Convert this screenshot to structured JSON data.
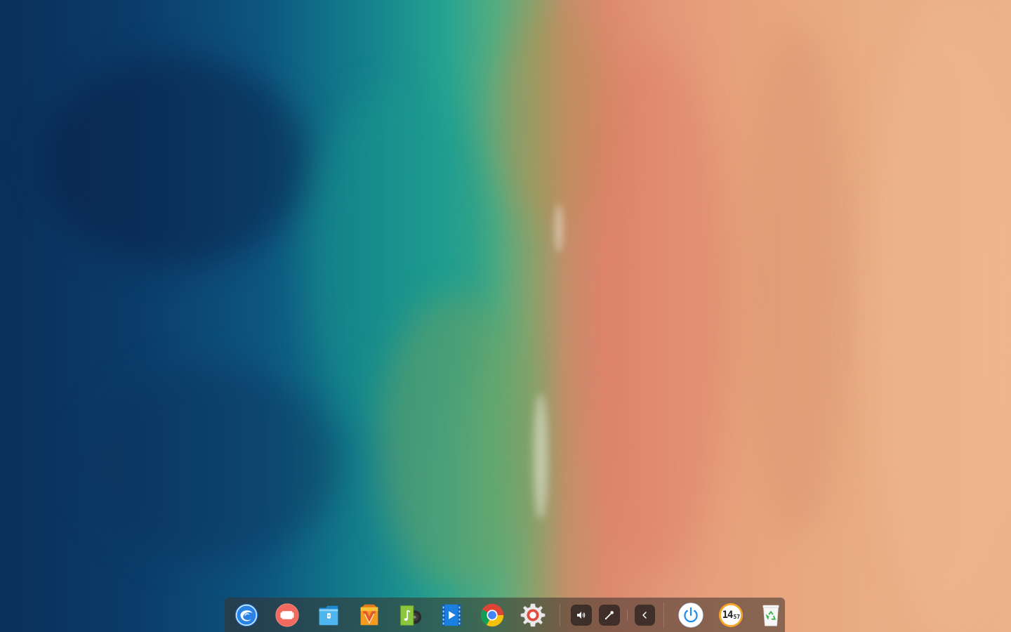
{
  "desktop": {
    "wallpaper": "aerial-beach-ocean"
  },
  "dock": {
    "apps": [
      {
        "name": "launcher",
        "icon": "deepin-launcher-icon"
      },
      {
        "name": "screen-recorder",
        "icon": "screen-recorder-icon"
      },
      {
        "name": "file-manager",
        "icon": "file-manager-icon"
      },
      {
        "name": "app-store",
        "icon": "app-store-icon"
      },
      {
        "name": "music",
        "icon": "music-icon"
      },
      {
        "name": "movie",
        "icon": "movie-icon"
      },
      {
        "name": "chrome",
        "icon": "chrome-icon"
      },
      {
        "name": "settings",
        "icon": "settings-gear-icon"
      }
    ],
    "tray": [
      {
        "name": "volume",
        "icon": "volume-icon"
      },
      {
        "name": "color-picker",
        "icon": "color-picker-icon"
      },
      {
        "name": "expand-tray",
        "icon": "chevron-left-icon"
      }
    ],
    "system": {
      "power_icon": "power-icon",
      "clock_hour": "14",
      "clock_minute": "57",
      "trash_icon": "trash-icon"
    }
  },
  "colors": {
    "dock_bg": "#3a322c",
    "accent_blue": "#1e8ef0",
    "clock_ring": "#f4a62a"
  }
}
